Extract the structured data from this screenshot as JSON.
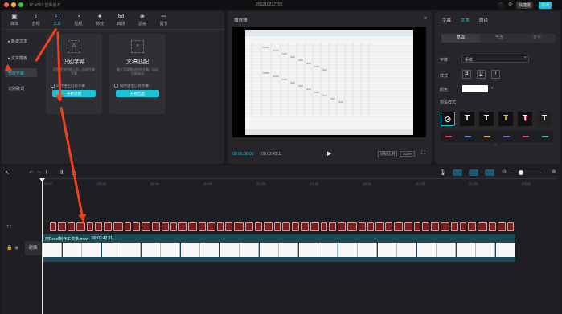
{
  "titlebar": {
    "app_text": "10:4553 基础版本",
    "project_title": "202210217705",
    "shortcut_label": "快捷键",
    "export_label": "导出"
  },
  "toolbar": [
    {
      "label": "媒体",
      "icon": "media-icon"
    },
    {
      "label": "音频",
      "icon": "audio-icon"
    },
    {
      "label": "文本",
      "icon": "text-icon"
    },
    {
      "label": "贴纸",
      "icon": "sticker-icon"
    },
    {
      "label": "特效",
      "icon": "effects-icon"
    },
    {
      "label": "转场",
      "icon": "transition-icon"
    },
    {
      "label": "滤镜",
      "icon": "filter-icon"
    },
    {
      "label": "调节",
      "icon": "adjust-icon"
    }
  ],
  "sidebar": [
    {
      "label": "▸ 新建文本"
    },
    {
      "label": "▸ 文字模板"
    },
    {
      "label": "智能字幕"
    },
    {
      "label": "识别歌词"
    }
  ],
  "cards": [
    {
      "title": "识别字幕",
      "desc": "识别音频中的人声，自动生成字幕",
      "checkbox": "同时清空已有字幕",
      "button": "开始识别"
    },
    {
      "title": "文稿匹配",
      "desc": "输入音视频对应的文稿，自动匹配画面",
      "checkbox": "同时清空已有字幕",
      "button": "开始匹配"
    }
  ],
  "player": {
    "title": "播放器",
    "time_current": "00:00:00:00",
    "time_total": "00:03:42:11",
    "ratio_label": "原始比例",
    "zoom_label": "100%"
  },
  "right_panel": {
    "tabs": [
      "字幕",
      "文本",
      "朗读"
    ],
    "segments": [
      "基础",
      "气泡",
      "花字"
    ],
    "font_label": "字体",
    "font_value": "系统",
    "style_label": "样式",
    "color_label": "颜色",
    "preset_label": "预设样式",
    "colors": {
      "accent": "#19c3d8",
      "arrow": "#f0401e"
    }
  },
  "timeline": {
    "ruler": [
      "00:00",
      "|00:20",
      "|00:40",
      "|01:00",
      "|01:20",
      "|01:40",
      "|02:00",
      "|02:20",
      "|02:40",
      "|03:00",
      "|03:20"
    ],
    "cover_label": "封面",
    "clip_name": "用Excel制作工资条.mov",
    "clip_duration": "00:03:42:11",
    "track_text_icon": "TT"
  }
}
